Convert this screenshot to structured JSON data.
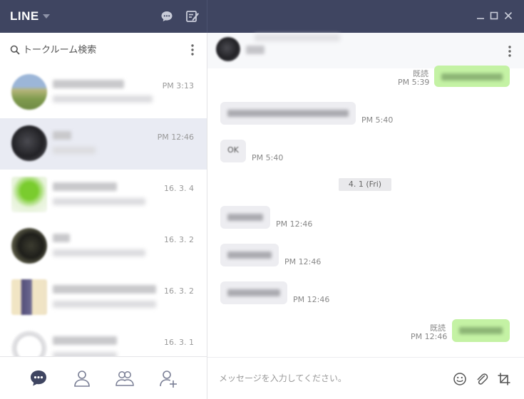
{
  "app": {
    "logo": "LINE"
  },
  "search": {
    "placeholder": "トークルーム検索"
  },
  "chats": [
    {
      "time": "PM 3:13",
      "name_w": 100,
      "preview_w": 140,
      "avatar": "landscape"
    },
    {
      "time": "PM 12:46",
      "name_w": 26,
      "preview_w": 60,
      "avatar": "dark"
    },
    {
      "time": "16. 3. 4",
      "name_w": 90,
      "preview_w": 130,
      "avatar": "green"
    },
    {
      "time": "16. 3. 2",
      "name_w": 24,
      "preview_w": 130,
      "avatar": "darkgreen"
    },
    {
      "time": "16. 3. 2",
      "name_w": 145,
      "preview_w": 145,
      "avatar": "purple"
    },
    {
      "time": "16. 3. 1",
      "name_w": 90,
      "preview_w": 90,
      "avatar": "ring"
    }
  ],
  "messages": {
    "m1": {
      "read": "既読",
      "time": "PM 5:39"
    },
    "m2": {
      "time": "PM 5:40"
    },
    "m3": {
      "text": "OK",
      "time": "PM 5:40"
    },
    "date": "4. 1 (Fri)",
    "m4": {
      "time": "PM 12:46"
    },
    "m5": {
      "time": "PM 12:46"
    },
    "m6": {
      "time": "PM 12:46"
    },
    "m7": {
      "read": "既読",
      "time": "PM 12:46"
    }
  },
  "composer": {
    "placeholder": "メッセージを入力してください。"
  },
  "colors": {
    "titlebar": "#3f4561",
    "out_bubble": "#c4f2a4",
    "in_bubble": "#ededf1",
    "active_row": "#e9ebf3"
  }
}
